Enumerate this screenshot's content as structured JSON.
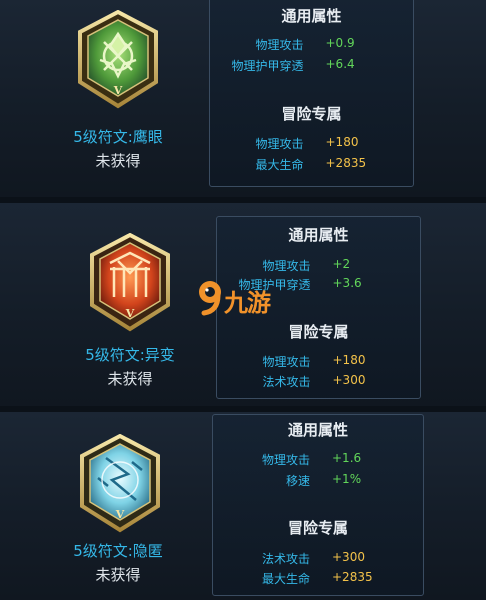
{
  "runes": [
    {
      "name": "5级符文:鹰眼",
      "status": "未获得",
      "emblem_color": "#5fa84a",
      "emblem_icon": "hawk-eye-rune-icon",
      "general": {
        "title": "通用属性",
        "stats": [
          {
            "label": "物理攻击",
            "value": "+0.9"
          },
          {
            "label": "物理护甲穿透",
            "value": "+6.4"
          }
        ]
      },
      "adventure": {
        "title": "冒险专属",
        "stats": [
          {
            "label": "物理攻击",
            "value": "+180"
          },
          {
            "label": "最大生命",
            "value": "+2835"
          }
        ]
      }
    },
    {
      "name": "5级符文:异变",
      "status": "未获得",
      "emblem_color": "#c8401c",
      "emblem_icon": "mutation-rune-icon",
      "general": {
        "title": "通用属性",
        "stats": [
          {
            "label": "物理攻击",
            "value": "+2"
          },
          {
            "label": "物理护甲穿透",
            "value": "+3.6"
          }
        ]
      },
      "adventure": {
        "title": "冒险专属",
        "stats": [
          {
            "label": "物理攻击",
            "value": "+180"
          },
          {
            "label": "法术攻击",
            "value": "+300"
          }
        ]
      }
    },
    {
      "name": "5级符文:隐匿",
      "status": "未获得",
      "emblem_color": "#7fd3e6",
      "emblem_icon": "stealth-rune-icon",
      "general": {
        "title": "通用属性",
        "stats": [
          {
            "label": "物理攻击",
            "value": "+1.6"
          },
          {
            "label": "移速",
            "value": "+1%"
          }
        ]
      },
      "adventure": {
        "title": "冒险专属",
        "stats": [
          {
            "label": "法术攻击",
            "value": "+300"
          },
          {
            "label": "最大生命",
            "value": "+2835"
          }
        ]
      }
    }
  ],
  "watermark": {
    "text": "九游",
    "logo_icon": "9game-logo-icon"
  },
  "colors": {
    "rune_name": "#35b8e8",
    "stat_label": "#35b8e8",
    "general_value": "#62d65a",
    "adventure_value": "#f3c24a",
    "watermark": "#f1922a"
  }
}
